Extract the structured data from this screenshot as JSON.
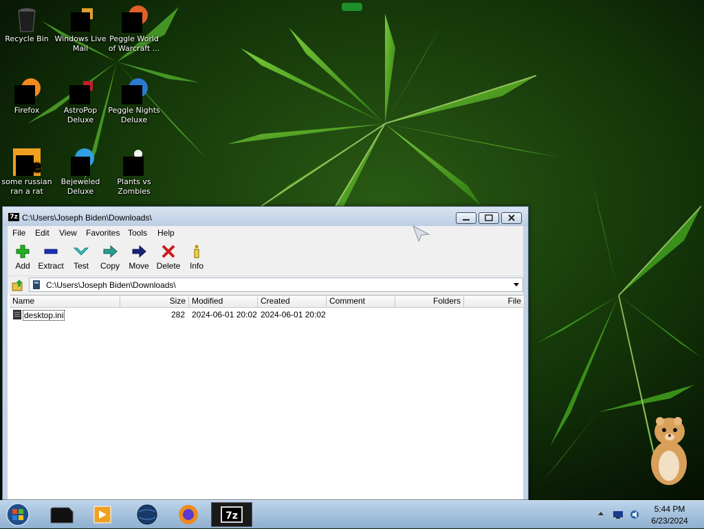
{
  "desktop": {
    "icons": [
      {
        "label": "Recycle Bin",
        "icon": "recycle-bin-icon"
      },
      {
        "label": "Windows Live Mail",
        "icon": "windows-live-mail-icon"
      },
      {
        "label": "Peggle World of Warcraft ...",
        "icon": "peggle-wow-icon"
      },
      {
        "label": "Firefox",
        "icon": "firefox-icon"
      },
      {
        "label": "AstroPop Deluxe",
        "icon": "astropop-icon"
      },
      {
        "label": "Peggle Nights Deluxe",
        "icon": "peggle-nights-icon"
      },
      {
        "label": "some russian ran a rat",
        "icon": "russian-rat-icon"
      },
      {
        "label": "Bejeweled Deluxe",
        "icon": "bejeweled-icon"
      },
      {
        "label": "Plants vs Zombies",
        "icon": "plants-vs-zombies-icon"
      }
    ]
  },
  "window": {
    "title": "C:\\Users\\Joseph Biden\\Downloads\\",
    "title_icon_text": "7z",
    "menu": [
      "File",
      "Edit",
      "View",
      "Favorites",
      "Tools",
      "Help"
    ],
    "toolbar": [
      {
        "label": "Add",
        "icon": "add-icon"
      },
      {
        "label": "Extract",
        "icon": "extract-icon"
      },
      {
        "label": "Test",
        "icon": "test-icon"
      },
      {
        "label": "Copy",
        "icon": "copy-icon"
      },
      {
        "label": "Move",
        "icon": "move-icon"
      },
      {
        "label": "Delete",
        "icon": "delete-icon"
      },
      {
        "label": "Info",
        "icon": "info-icon"
      }
    ],
    "address": "C:\\Users\\Joseph Biden\\Downloads\\",
    "columns": [
      "Name",
      "Size",
      "Modified",
      "Created",
      "Comment",
      "Folders",
      "File"
    ],
    "rows": [
      {
        "name": "desktop.ini",
        "size": "282",
        "modified": "2024-06-01 20:02",
        "created": "2024-06-01 20:02",
        "comment": "",
        "folders": "",
        "files": ""
      }
    ]
  },
  "taskbar": {
    "items": [
      {
        "name": "taskbar-start-orb",
        "icon": "windows-start-icon"
      },
      {
        "name": "taskbar-item-black-box",
        "icon": "black-box-icon"
      },
      {
        "name": "taskbar-item-media-player",
        "icon": "media-player-icon"
      },
      {
        "name": "taskbar-item-globe",
        "icon": "globe-icon"
      },
      {
        "name": "taskbar-item-firefox",
        "icon": "firefox-icon"
      },
      {
        "name": "taskbar-item-7zip",
        "icon": "7zip-icon",
        "label": "7z"
      }
    ],
    "clock_time": "5:44 PM",
    "clock_date": "6/23/2024"
  },
  "colors": {
    "title_bar": "#c4d3e6",
    "taskbar": "#a8c2dd",
    "wallpaper_leaf": "#3f9a1c",
    "wallpaper_bg": "#0b1f08"
  }
}
